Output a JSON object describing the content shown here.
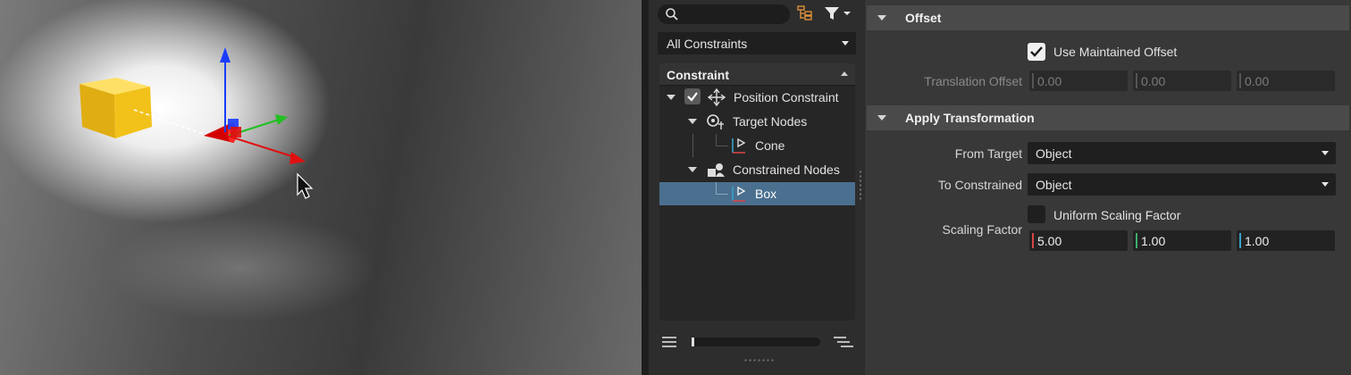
{
  "outliner": {
    "filter_dropdown": "All Constraints",
    "tree_header": "Constraint",
    "rows": [
      {
        "label": "Position Constraint",
        "checked": true
      },
      {
        "label": "Target Nodes"
      },
      {
        "label": "Cone"
      },
      {
        "label": "Constrained Nodes"
      },
      {
        "label": "Box",
        "selected": true
      }
    ]
  },
  "attributes": {
    "offset_section": "Offset",
    "use_maintained_offset": {
      "label": "Use Maintained Offset",
      "checked": true
    },
    "translation_offset": {
      "label": "Translation Offset",
      "values": [
        "0.00",
        "0.00",
        "0.00"
      ]
    },
    "apply_section": "Apply Transformation",
    "from_target": {
      "label": "From Target",
      "value": "Object"
    },
    "to_constrained": {
      "label": "To Constrained",
      "value": "Object"
    },
    "scaling_factor": {
      "label": "Scaling Factor",
      "uniform_label": "Uniform Scaling Factor",
      "uniform_checked": false,
      "values": [
        "5.00",
        "1.00",
        "1.00"
      ]
    }
  },
  "colors": {
    "axis_x": "#d64545",
    "axis_y": "#3fae6a",
    "axis_z": "#3aa0c8",
    "selection": "#4a6f8f",
    "box": "#f2c21a",
    "cone": "#e00000"
  },
  "icons": [
    "search-icon",
    "outliner-view-icon",
    "filter-icon",
    "move-icon",
    "target-nodes-icon",
    "node-icon",
    "constrained-nodes-icon",
    "list-icon",
    "indent-list-icon",
    "checkmark-icon"
  ]
}
